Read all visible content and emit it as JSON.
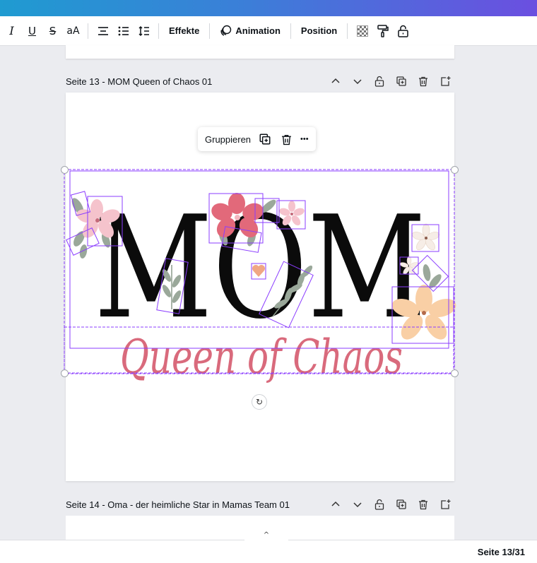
{
  "toolbar": {
    "italic_glyph": "I",
    "underline_glyph": "U",
    "strike_glyph": "S",
    "case_label": "aA",
    "effects_label": "Effekte",
    "animation_label": "Animation",
    "position_label": "Position"
  },
  "pages": {
    "current": {
      "title": "Seite 13 - MOM Queen of Chaos 01"
    },
    "next": {
      "title": "Seite 14 - Oma - der heimliche Star in Mamas Team 01"
    }
  },
  "context_menu": {
    "group_label": "Gruppieren",
    "more_glyph": "•••"
  },
  "design": {
    "headline": "MOM",
    "script_text": "Queen of Chaos",
    "colors": {
      "headline": "#0b0b0b",
      "script": "#d96a7c",
      "selection": "#8b3dff",
      "flower_pink": "#f5c3cc",
      "flower_red": "#e2697a",
      "flower_peach": "#f9cfa5",
      "leaf": "#9aa89a"
    }
  },
  "footer": {
    "page_indicator": "Seite 13/31"
  },
  "icons": {
    "collapse": "^"
  }
}
